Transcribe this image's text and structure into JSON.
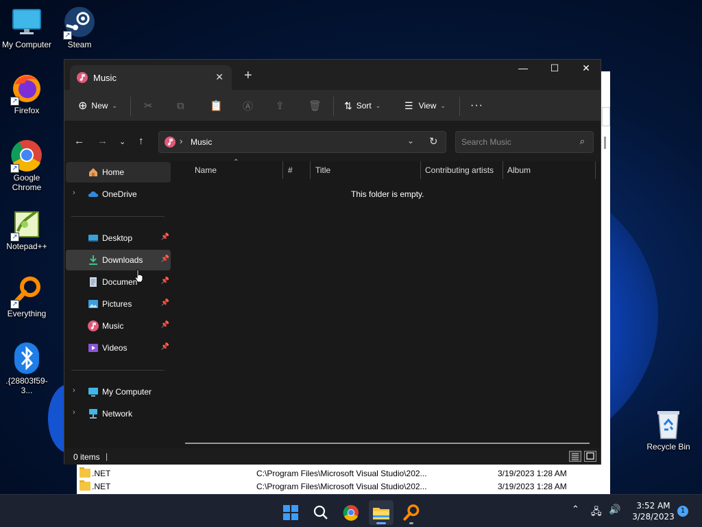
{
  "desktop": {
    "icons": [
      {
        "label": "My Computer",
        "icon": "monitor-icon"
      },
      {
        "label": "Steam",
        "icon": "steam-icon"
      },
      {
        "label": "Firefox",
        "icon": "firefox-icon"
      },
      {
        "label": "Google Chrome",
        "icon": "chrome-icon"
      },
      {
        "label": "Notepad++",
        "icon": "notepadpp-icon"
      },
      {
        "label": "Everything",
        "icon": "everything-icon"
      },
      {
        "label": ".{28803f59-3...",
        "icon": "bluetooth-icon"
      },
      {
        "label": "Recycle Bin",
        "icon": "recycle-bin-icon"
      }
    ]
  },
  "background_window": {
    "rows": [
      {
        "name": ".NET",
        "path": "C:\\Program Files\\Microsoft Visual Studio\\202...",
        "date": "3/19/2023 1:28 AM"
      },
      {
        "name": ".NET",
        "path": "C:\\Program Files\\Microsoft Visual Studio\\202...",
        "date": "3/19/2023 1:28 AM"
      }
    ]
  },
  "explorer": {
    "tab_title": "Music",
    "toolbar": {
      "new_label": "New",
      "sort_label": "Sort",
      "view_label": "View",
      "more_label": "···"
    },
    "address": {
      "crumb": "Music",
      "search_placeholder": "Search Music"
    },
    "nav": {
      "home": "Home",
      "onedrive": "OneDrive",
      "desktop": "Desktop",
      "downloads": "Downloads",
      "documents": "Documen",
      "pictures": "Pictures",
      "music": "Music",
      "videos": "Videos",
      "my_computer": "My Computer",
      "network": "Network"
    },
    "columns": {
      "name": "Name",
      "number": "#",
      "title": "Title",
      "artists": "Contributing artists",
      "album": "Album"
    },
    "empty_message": "This folder is empty.",
    "status": "0 items"
  },
  "taskbar": {
    "time": "3:52 AM",
    "date": "3/28/2023",
    "notification_count": "1"
  },
  "colors": {
    "accent": "#4aa3ff",
    "window_bg": "#191919",
    "toolbar_bg": "#2c2c2c"
  }
}
